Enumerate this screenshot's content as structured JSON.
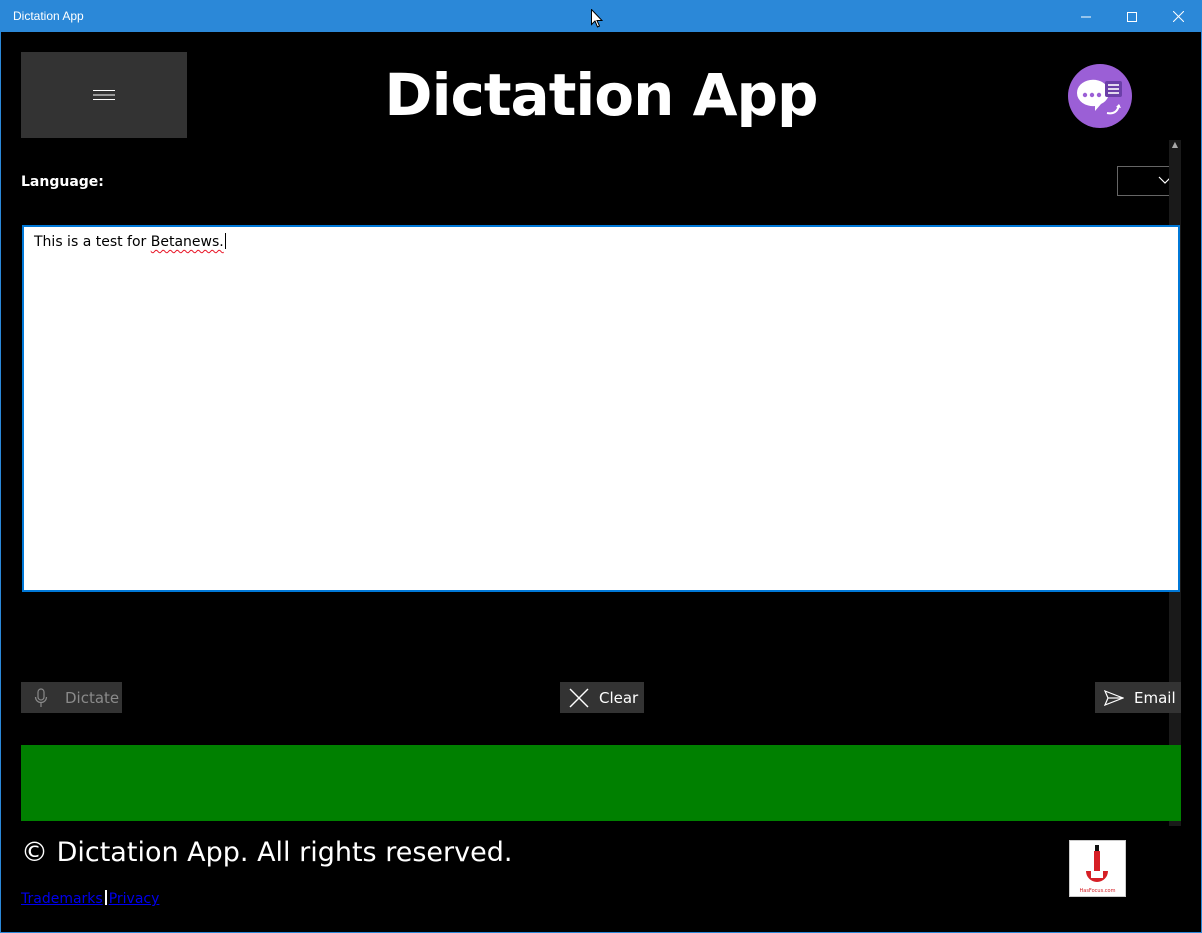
{
  "window": {
    "title": "Dictation App",
    "controls": {
      "minimize": "minimize-icon",
      "maximize": "maximize-icon",
      "close": "close-icon"
    }
  },
  "header": {
    "menu_icon": "hamburger-menu-icon",
    "title": "Dictation App",
    "logo_icon": "speech-bubble-logo-icon"
  },
  "language": {
    "label": "Language:",
    "selected": "",
    "dropdown_icon": "chevron-down-icon"
  },
  "editor": {
    "text_before": "This is a test for ",
    "misspelled_word": "Betanews.",
    "text_after": ""
  },
  "actions": {
    "dictate_label": "Dictate",
    "clear_label": "Clear",
    "email_label": "Email"
  },
  "status_bar": {
    "color": "#008000"
  },
  "footer": {
    "copyright": "© Dictation App. All rights reserved.",
    "trademarks_link": "Trademarks",
    "separator": "|",
    "privacy_link": "Privacy",
    "badge_caption": "HasFocus.com"
  },
  "colors": {
    "titlebar": "#2b88d8",
    "accent": "#0078d7",
    "background": "#000000",
    "button": "#333333",
    "logo": "#9b5fd6"
  }
}
